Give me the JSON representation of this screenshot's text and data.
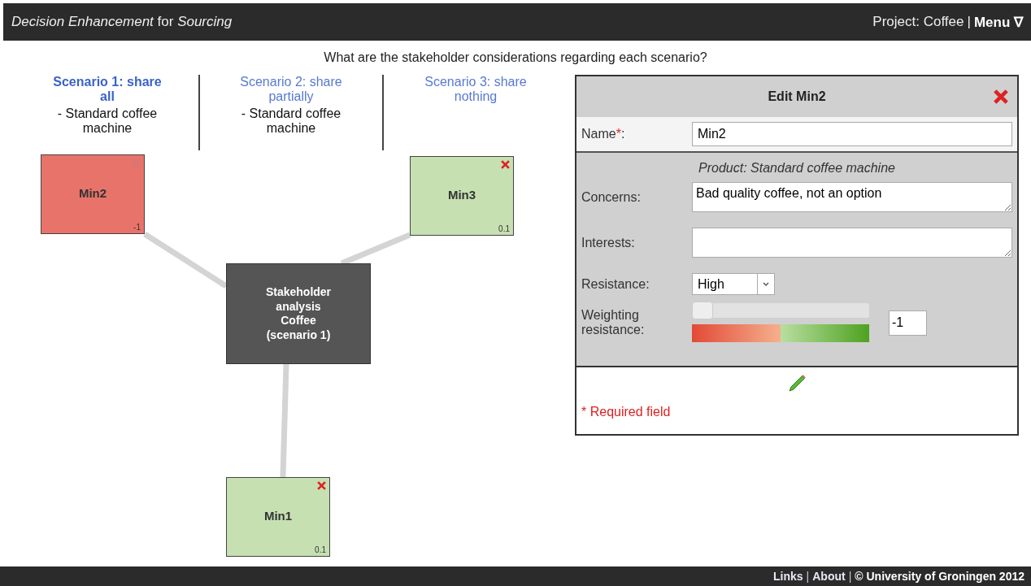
{
  "header": {
    "title": "*Decision Enhancement* for *Sourcing*",
    "project": "Project: Coffee",
    "separator": "|",
    "menu": "Menu ∇"
  },
  "question": "What are the stakeholder considerations regarding each scenario?",
  "scenarios": [
    {
      "title": "Scenario 1: share all",
      "product": "- Standard coffee machine",
      "selected": true
    },
    {
      "title": "Scenario 2: share partially",
      "product": "- Standard coffee machine",
      "selected": false
    },
    {
      "title": "Scenario 3: share nothing",
      "selected": false
    }
  ],
  "diagram": {
    "center": "Stakeholder analysis Coffee (scenario 1)",
    "nodes": [
      {
        "name": "Min2",
        "value": "-1",
        "color": "#e8736a",
        "selected": true
      },
      {
        "name": "Min3",
        "value": "0.1",
        "color": "#c6e0b2",
        "selected": false
      },
      {
        "name": "Min1",
        "value": "0.1",
        "color": "#c6e0b2",
        "selected": false
      }
    ]
  },
  "edit_panel": {
    "title": "Edit Min2",
    "name_label": "Name",
    "required_mark": "*",
    "name_suffix": ":",
    "name_value": "Min2",
    "product": "Product: Standard coffee machine",
    "concerns_label": "Concerns:",
    "concerns_value": "Bad quality coffee, not an option",
    "interests_label": "Interests:",
    "resistance_label": "Resistance:",
    "resistance_value": "High",
    "weighting_label": "Weighting resistance:",
    "weighting": {
      "level": 0
    },
    "weighting_value": "-1",
    "required_note": "* Required field"
  },
  "footer": {
    "items": [
      {
        "kind": "link",
        "text": "Links"
      },
      {
        "kind": "separator",
        "text": "|"
      },
      {
        "kind": "link",
        "text": "About"
      },
      {
        "kind": "separator",
        "text": "|"
      },
      {
        "kind": "text",
        "text": "© University of Groningen 2012"
      }
    ]
  }
}
